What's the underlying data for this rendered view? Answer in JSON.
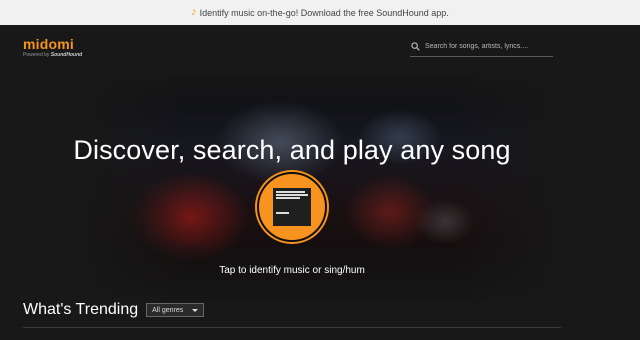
{
  "promo": {
    "icon": "music-note-icon",
    "text": "Identify music on-the-go! Download the free SoundHound app."
  },
  "header": {
    "logo_text": "midomi",
    "powered_by": "Powered by",
    "powered_brand": "SoundHound",
    "search_placeholder": "Search for songs, artists, lyrics....",
    "search_value": ""
  },
  "hero": {
    "title": "Discover, search, and play any song",
    "tap_text": "Tap to identify music or sing/hum"
  },
  "trending": {
    "title": "What's Trending",
    "genre_selected": "All genres"
  },
  "colors": {
    "accent": "#f7931e",
    "background": "#181818",
    "promo_bar": "#f1f1f1"
  }
}
